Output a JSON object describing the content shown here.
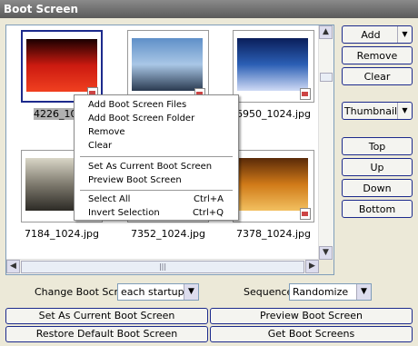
{
  "title": "Boot Screen",
  "thumbnails": [
    {
      "caption": "4226_1024",
      "selected": true,
      "colors": [
        "#1a0000",
        "#cc1a10",
        "#f04020"
      ]
    },
    {
      "caption": "",
      "selected": false,
      "colors": [
        "#5f8fc8",
        "#a9c7e6",
        "#2a3a50"
      ]
    },
    {
      "caption": "6950_1024.jpg",
      "selected": false,
      "colors": [
        "#0a1e5a",
        "#2b5fb5",
        "#cfdaf5"
      ]
    },
    {
      "caption": "7184_1024.jpg",
      "selected": false,
      "colors": [
        "#d9d6c7",
        "#7e7a6e",
        "#2c2a25"
      ]
    },
    {
      "caption": "7352_1024.jpg",
      "selected": false,
      "colors": [
        "#c7d3d9",
        "#6e8fa1",
        "#324a55"
      ]
    },
    {
      "caption": "7378_1024.jpg",
      "selected": false,
      "colors": [
        "#5a2a08",
        "#d07a18",
        "#f2c060"
      ]
    }
  ],
  "side_buttons": {
    "add": "Add",
    "remove": "Remove",
    "clear": "Clear",
    "view_mode": "Thumbnail",
    "top": "Top",
    "up": "Up",
    "down": "Down",
    "bottom": "Bottom"
  },
  "context_menu": {
    "items": [
      {
        "label": "Add Boot Screen Files",
        "shortcut": ""
      },
      {
        "label": "Add Boot Screen Folder",
        "shortcut": ""
      },
      {
        "label": "Remove",
        "shortcut": ""
      },
      {
        "label": "Clear",
        "shortcut": ""
      },
      {
        "label": "Set As Current Boot Screen",
        "shortcut": ""
      },
      {
        "label": "Preview Boot Screen",
        "shortcut": ""
      },
      {
        "label": "Select All",
        "shortcut": "Ctrl+A"
      },
      {
        "label": "Invert Selection",
        "shortcut": "Ctrl+Q"
      }
    ]
  },
  "options": {
    "change_label": "Change Boot Screen :",
    "change_value": "each startup",
    "sequence_label": "Sequence :",
    "sequence_value": "Randomize"
  },
  "bottom_buttons": {
    "set_current": "Set As Current Boot Screen",
    "preview": "Preview Boot Screen",
    "restore": "Restore Default Boot Screen",
    "get": "Get Boot Screens"
  },
  "glyphs": {
    "arrow_down": "▼",
    "arrow_up": "▲",
    "arrow_left": "◀",
    "arrow_right": "▶",
    "grip": "|||"
  }
}
